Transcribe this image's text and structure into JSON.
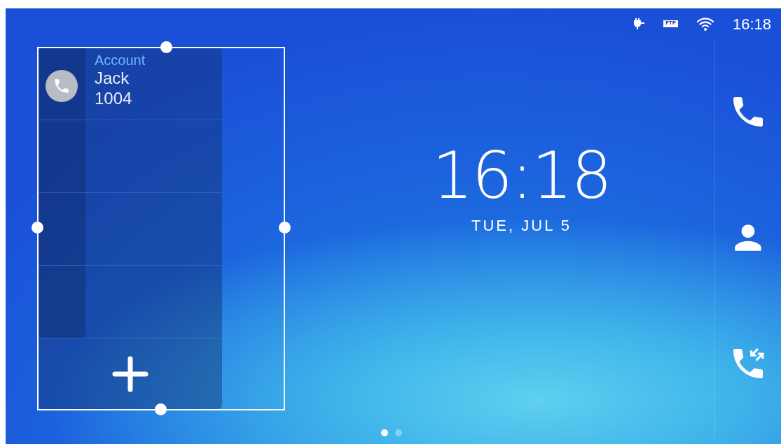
{
  "status_bar": {
    "ftp_label": "FTP",
    "time": "16:18"
  },
  "account_widget": {
    "label": "Account",
    "name": "Jack",
    "number": "1004"
  },
  "clock": {
    "time": "16:18",
    "date": "TUE, JUL 5"
  },
  "page_indicator": [
    {
      "selected": true
    },
    {
      "selected": false
    }
  ]
}
